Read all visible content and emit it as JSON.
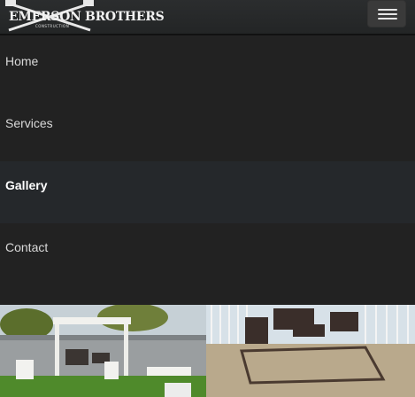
{
  "header": {
    "logo_text": "EMERSON BROTHERS",
    "logo_subtext": "CONSTRUCTION",
    "menu_toggle_icon": "hamburger-icon"
  },
  "nav": {
    "items": [
      {
        "label": "Home",
        "active": false
      },
      {
        "label": "Services",
        "active": false
      },
      {
        "label": "Gallery",
        "active": true
      },
      {
        "label": "Contact",
        "active": false
      }
    ]
  },
  "gallery": {
    "images": [
      {
        "subject": "pergola-backyard-photo"
      },
      {
        "subject": "deck-patio-furniture-photo"
      }
    ]
  },
  "colors": {
    "background": "#222222",
    "active_item_bg": "#25282b",
    "text": "#d9d9d9",
    "active_text": "#ffffff"
  }
}
